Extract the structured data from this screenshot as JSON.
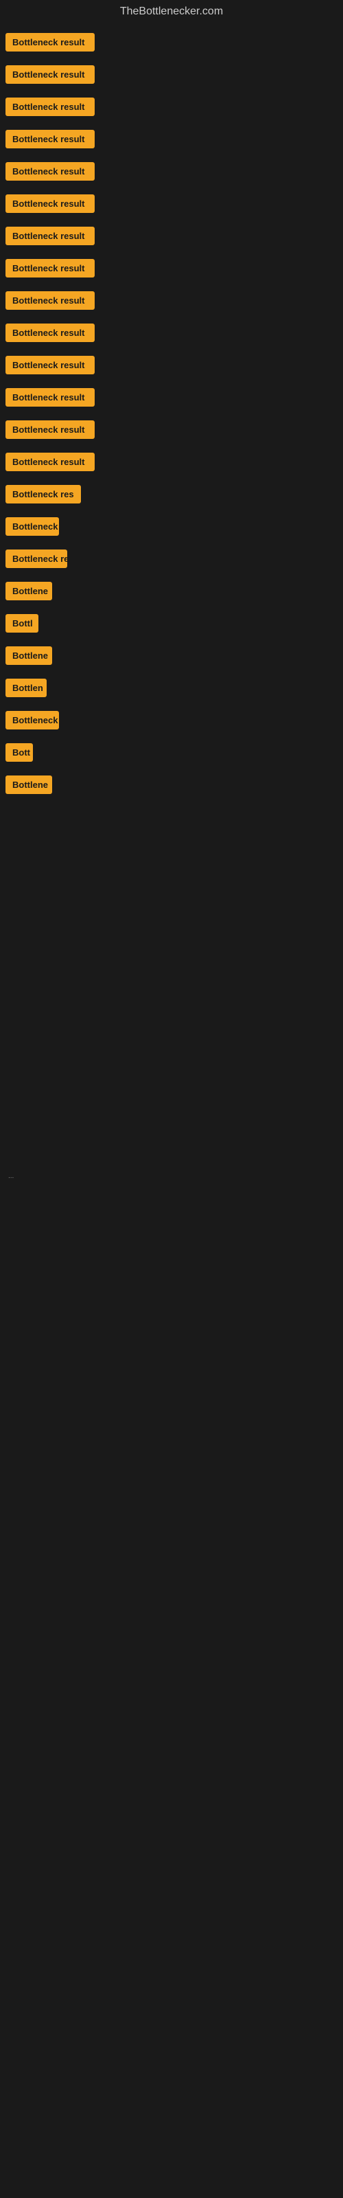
{
  "site": {
    "title": "TheBottlenecker.com"
  },
  "items": [
    {
      "label": "Bottleneck result",
      "width": 130
    },
    {
      "label": "Bottleneck result",
      "width": 130
    },
    {
      "label": "Bottleneck result",
      "width": 130
    },
    {
      "label": "Bottleneck result",
      "width": 130
    },
    {
      "label": "Bottleneck result",
      "width": 130
    },
    {
      "label": "Bottleneck result",
      "width": 130
    },
    {
      "label": "Bottleneck result",
      "width": 130
    },
    {
      "label": "Bottleneck result",
      "width": 130
    },
    {
      "label": "Bottleneck result",
      "width": 130
    },
    {
      "label": "Bottleneck result",
      "width": 130
    },
    {
      "label": "Bottleneck result",
      "width": 130
    },
    {
      "label": "Bottleneck result",
      "width": 130
    },
    {
      "label": "Bottleneck result",
      "width": 130
    },
    {
      "label": "Bottleneck result",
      "width": 130
    },
    {
      "label": "Bottleneck res",
      "width": 110
    },
    {
      "label": "Bottleneck",
      "width": 78
    },
    {
      "label": "Bottleneck re",
      "width": 90
    },
    {
      "label": "Bottlene",
      "width": 68
    },
    {
      "label": "Bottl",
      "width": 48
    },
    {
      "label": "Bottlene",
      "width": 68
    },
    {
      "label": "Bottlen",
      "width": 60
    },
    {
      "label": "Bottleneck",
      "width": 78
    },
    {
      "label": "Bott",
      "width": 40
    },
    {
      "label": "Bottlene",
      "width": 68
    }
  ],
  "footer_dot": "..."
}
